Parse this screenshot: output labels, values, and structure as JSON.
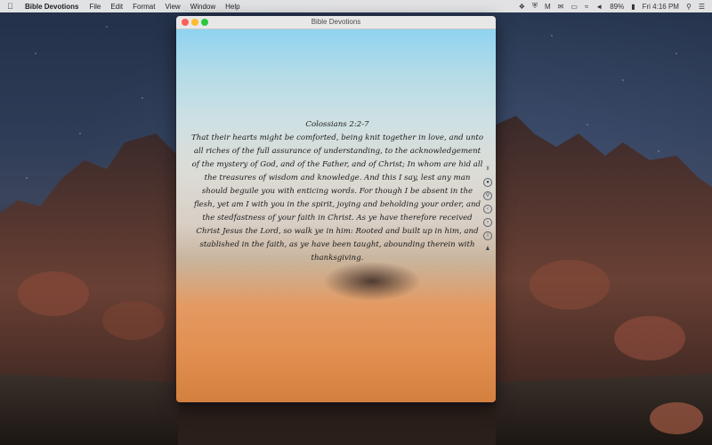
{
  "menubar": {
    "apple_icon": "apple-logo",
    "app_name": "Bible Devotions",
    "menus": [
      "File",
      "Edit",
      "Format",
      "View",
      "Window",
      "Help"
    ],
    "battery": "89%",
    "clock": "Fri 4:16 PM",
    "status_icons": [
      "dropbox-icon",
      "shield-icon",
      "gmail-icon",
      "mail-icon",
      "airplay-icon",
      "wifi-icon",
      "volume-icon",
      "battery-icon",
      "search-icon",
      "list-icon"
    ]
  },
  "window": {
    "title": "Bible Devotions"
  },
  "verse": {
    "reference": "Colossians 2:2-7",
    "text": "That their hearts might be comforted, being knit together in love, and unto all riches of the full assurance of understanding, to the acknowledgement of the mystery of God, and of the Father, and of Christ; In whom are hid all the treasures of wisdom and knowledge. And this I say, lest any man should beguile you with enticing words. For though I be absent in the flesh, yet am I with you in the spirit, joying and beholding your order, and the stedfastness of your faith in Christ. As ye have therefore received Christ Jesus the Lord, so walk ye in him: Rooted and built up in him, and stablished in the faith, as ye have been taught, abounding therein with thanksgiving."
  },
  "side_controls": [
    "scroll-icon",
    "history-icon",
    "search-icon",
    "back-icon",
    "forward-icon",
    "info-icon",
    "person-icon"
  ]
}
